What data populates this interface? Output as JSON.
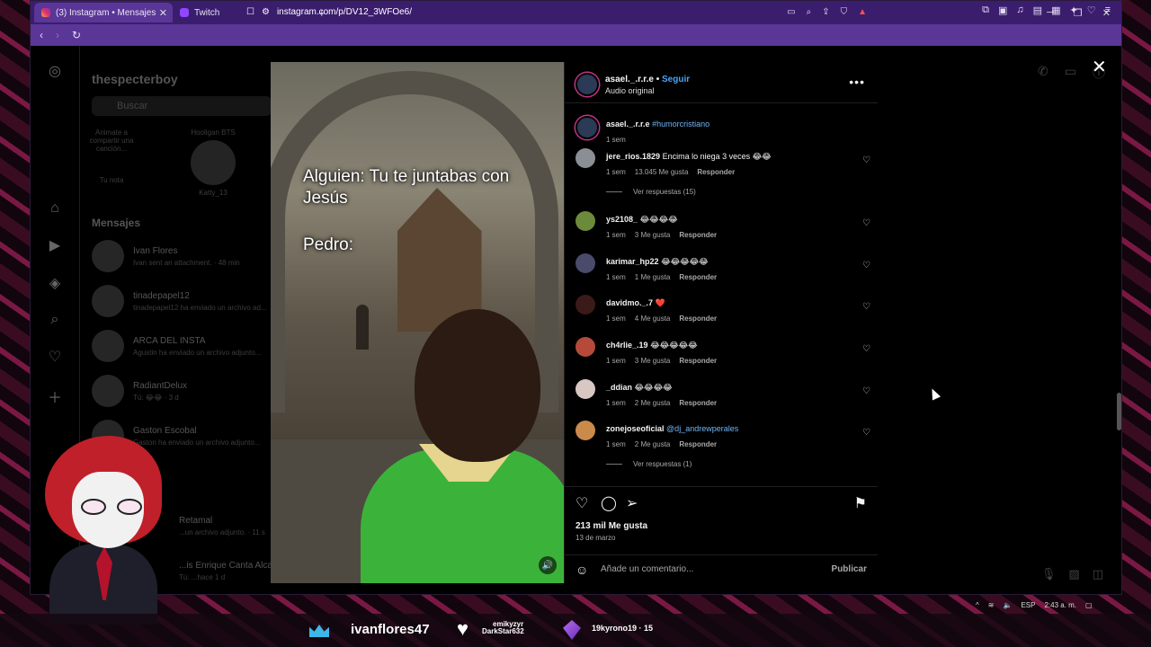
{
  "browser": {
    "tabs": [
      {
        "label": "(3) Instagram • Mensajes",
        "active": true
      },
      {
        "label": "Twitch",
        "active": false
      }
    ],
    "url": "instagram.com/p/DV12_3WFOe6/"
  },
  "ig": {
    "username": "thespecterboy",
    "search_placeholder": "Buscar",
    "notes": [
      {
        "label": "Tu nota",
        "bubble": "Animate a compartir una canción..."
      },
      {
        "label": "Katty_13",
        "bubble": "Hooligan BTS"
      }
    ],
    "messages_header": "Mensajes",
    "threads": [
      {
        "name": "Ivan Flores",
        "preview": "Ivan sent an attachment. · 48 min"
      },
      {
        "name": "tinadepapel12",
        "preview": "tinadepapel12 ha enviado un archivo ad..."
      },
      {
        "name": "ARCA DEL INSTA",
        "preview": "Agustin ha enviado un archivo adjunto..."
      },
      {
        "name": "RadiantDelux",
        "preview": "Tú: 😂😂 · 3 d"
      },
      {
        "name": "Gaston Escobal",
        "preview": "Gaston ha enviado un archivo adjunto..."
      },
      {
        "name": "Retamal",
        "preview": "...un archivo adjunto. · 11 s"
      },
      {
        "name": "...is Enrique Canta Alcala",
        "preview": "Tú: ...hace 1 d"
      }
    ]
  },
  "video": {
    "caption_1": "Alguien: Tu te juntabas con Jesús",
    "caption_2": "Pedro:"
  },
  "post": {
    "author": "asael._.r.r.e",
    "follow": "Seguir",
    "audio": "Audio original",
    "caption_author": "asael._.r.r.e",
    "caption_tag": "#humorcristiano",
    "caption_time": "1 sem",
    "comments": [
      {
        "user": "jere_rios.1829",
        "text": "Encima lo niega 3 veces 😂😂",
        "time": "1 sem",
        "likes": "13.045 Me gusta",
        "reply": "Responder",
        "replies": "Ver respuestas (15)",
        "avatar_color": "#8a8f95"
      },
      {
        "user": "ys2108_",
        "text": "😂😂😂😂",
        "time": "1 sem",
        "likes": "3 Me gusta",
        "reply": "Responder",
        "avatar_color": "#6c8b3a"
      },
      {
        "user": "karimar_hp22",
        "text": "😂😂😂😂😂",
        "time": "1 sem",
        "likes": "1 Me gusta",
        "reply": "Responder",
        "avatar_color": "#4a4a6b"
      },
      {
        "user": "davidmo._.7",
        "text": "❤️",
        "time": "1 sem",
        "likes": "4 Me gusta",
        "reply": "Responder",
        "avatar_color": "#3b1a1a"
      },
      {
        "user": "ch4rlie_.19",
        "text": "😂😂😂😂😂",
        "time": "1 sem",
        "likes": "3 Me gusta",
        "reply": "Responder",
        "avatar_color": "#b54a3a"
      },
      {
        "user": "_ddian",
        "text": "😂😂😂😂",
        "time": "1 sem",
        "likes": "2 Me gusta",
        "reply": "Responder",
        "avatar_color": "#d8c7c2"
      },
      {
        "user": "zonejoseoficial",
        "text": "@dj_andrewperales",
        "time": "1 sem",
        "likes": "2 Me gusta",
        "reply": "Responder",
        "replies": "Ver respuestas (1)",
        "avatar_color": "#c98a4b"
      }
    ],
    "like_count": "213 mil Me gusta",
    "date": "13 de marzo",
    "comment_placeholder": "Añade un comentario...",
    "publish": "Publicar"
  },
  "taskbar": {
    "lang": "ESP",
    "time": "2:43 a. m."
  },
  "stream": {
    "top_user": "ivanflores47",
    "hearts_user_a": "emikyzyr",
    "hearts_user_b": "DarkStar632",
    "gem_user": "19kyrono19",
    "gem_count": "15"
  }
}
